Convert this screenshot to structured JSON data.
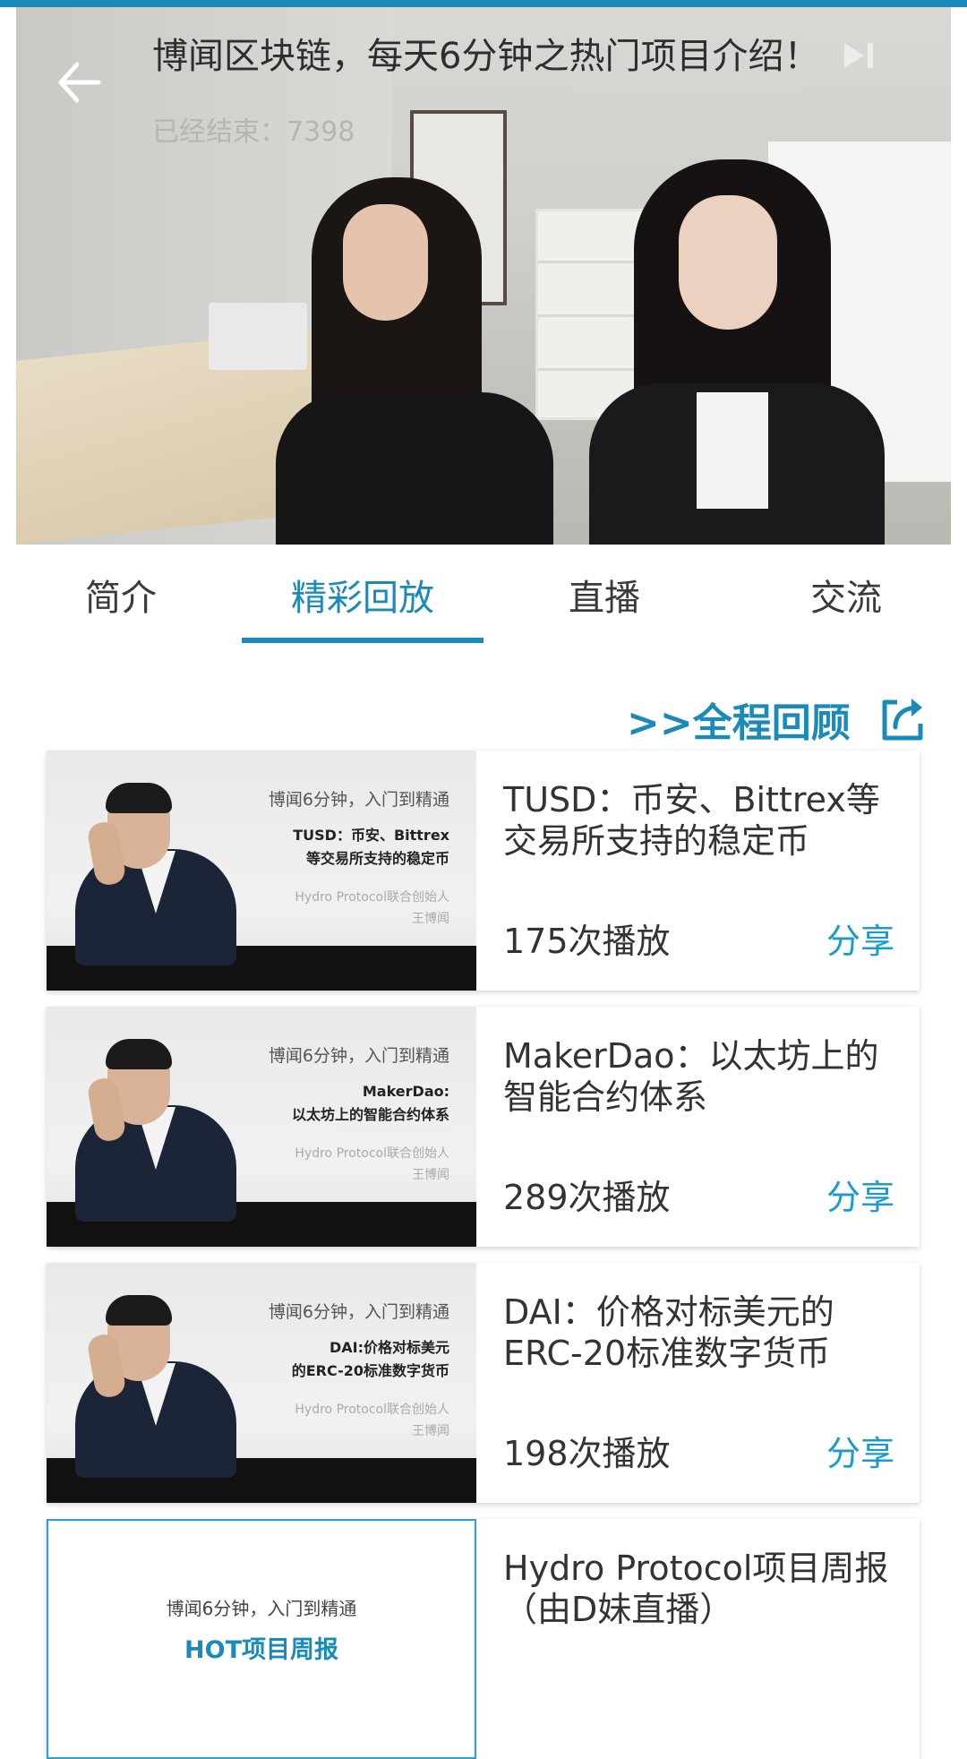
{
  "video": {
    "title": "博闻区块链，每天6分钟之热门项目介绍！",
    "status": "已经结束：7398"
  },
  "tabs": [
    {
      "label": "简介",
      "active": false
    },
    {
      "label": "精彩回放",
      "active": true
    },
    {
      "label": "直播",
      "active": false
    },
    {
      "label": "交流",
      "active": false
    }
  ],
  "replay": {
    "full_review_label": ">>全程回顾"
  },
  "items": [
    {
      "thumb_tagline": "博闻6分钟，入门到精通",
      "thumb_title_line1": "TUSD：币安、Bittrex",
      "thumb_title_line2": "等交易所支持的稳定币",
      "thumb_author_line1": "Hydro Protocol联合创始人",
      "thumb_author_line2": "王博闻",
      "title": "TUSD：币安、Bittrex等交易所支持的稳定币",
      "plays": "175次播放",
      "share": "分享"
    },
    {
      "thumb_tagline": "博闻6分钟，入门到精通",
      "thumb_title_line1": "MakerDao:",
      "thumb_title_line2": "以太坊上的智能合约体系",
      "thumb_author_line1": "Hydro Protocol联合创始人",
      "thumb_author_line2": "王博闻",
      "title": "MakerDao：以太坊上的智能合约体系",
      "plays": "289次播放",
      "share": "分享"
    },
    {
      "thumb_tagline": "博闻6分钟，入门到精通",
      "thumb_title_line1": "DAI:价格对标美元",
      "thumb_title_line2": "的ERC-20标准数字货币",
      "thumb_author_line1": "Hydro Protocol联合创始人",
      "thumb_author_line2": "王博闻",
      "title": "DAI：价格对标美元的ERC-20标准数字货币",
      "plays": "198次播放",
      "share": "分享"
    },
    {
      "thumb_tagline": "博闻6分钟，入门到精通",
      "thumb_title_line1": "HOT项目周报",
      "title": "Hydro Protocol项目周报（由D妹直播）"
    }
  ],
  "colors": {
    "accent": "#1a8ab8",
    "share": "#1a9bd0"
  }
}
